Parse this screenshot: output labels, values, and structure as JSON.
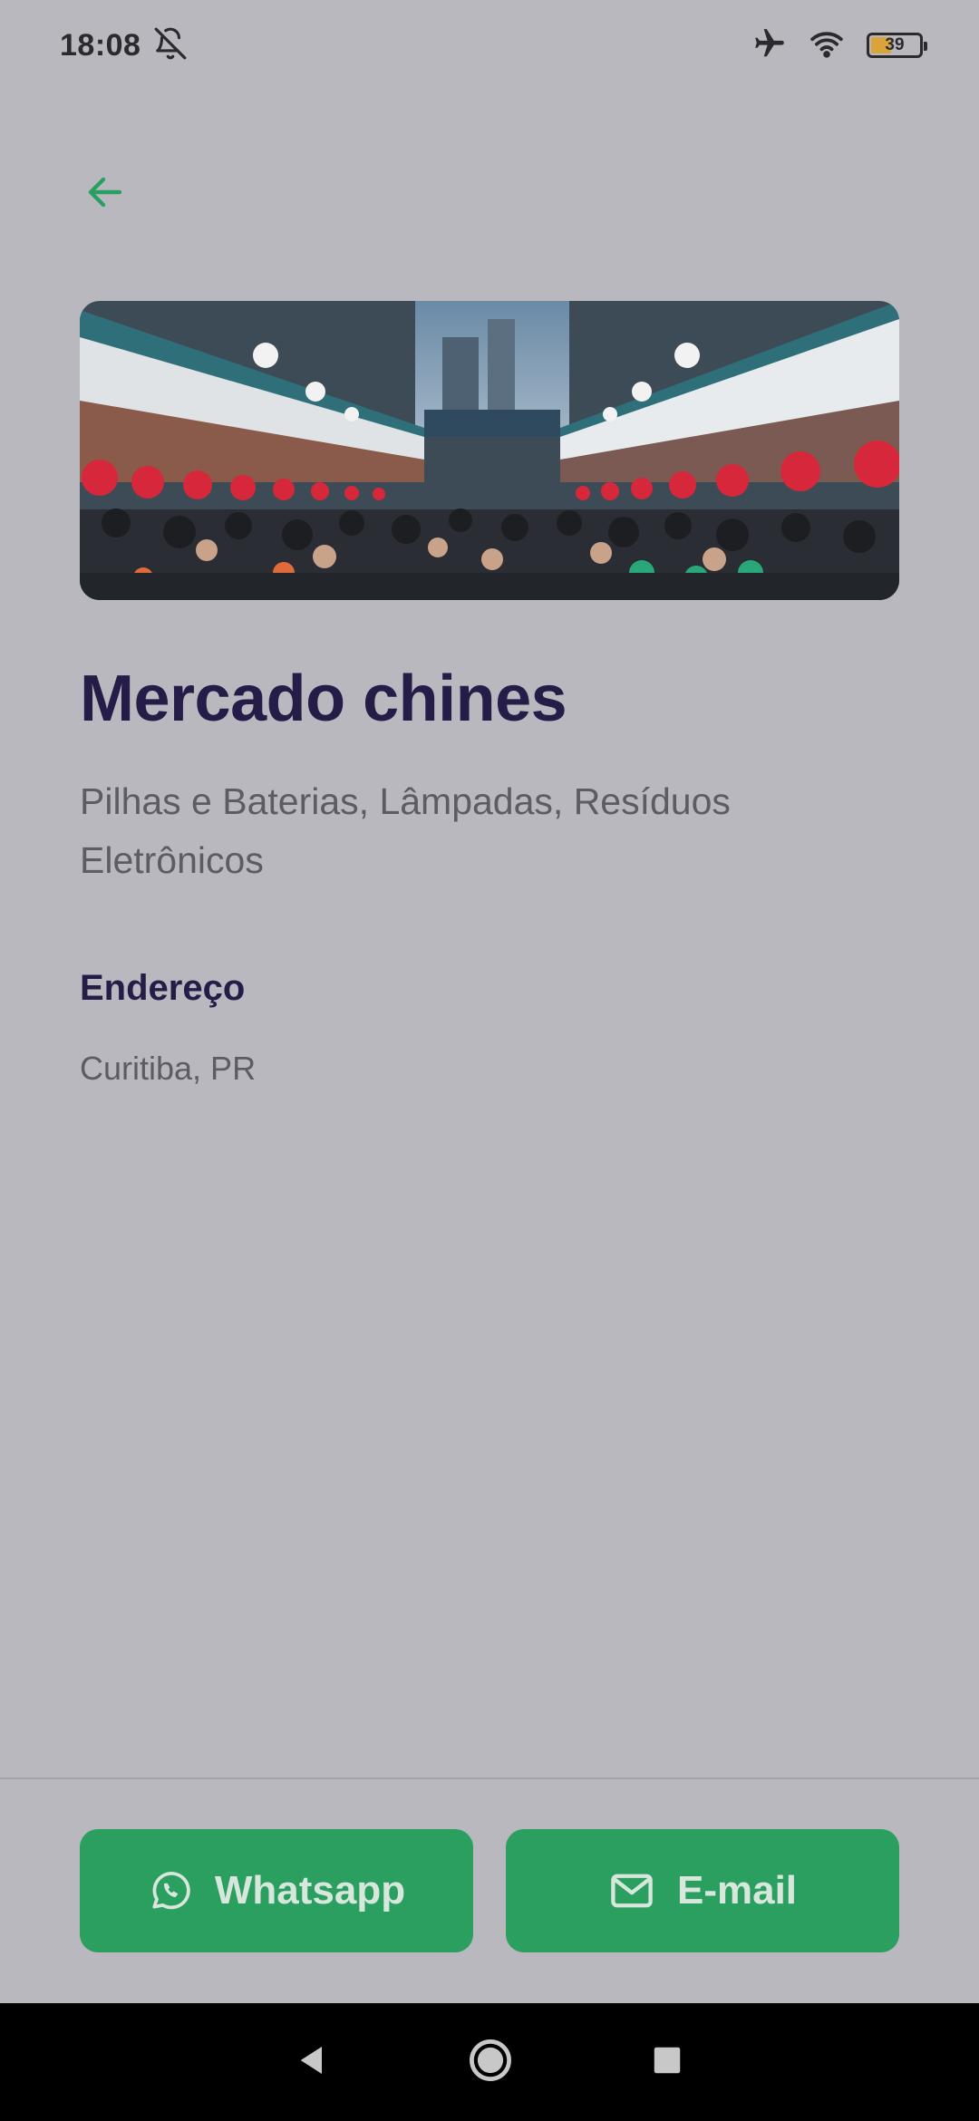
{
  "status_bar": {
    "time": "18:08",
    "battery": "39",
    "icons": [
      "bell-off-icon",
      "airplane-icon",
      "wifi-icon",
      "battery-icon"
    ]
  },
  "header": {
    "back_icon": "arrow-left-icon"
  },
  "place": {
    "name": "Mercado chines",
    "categories": "Pilhas e Baterias, Lâmpadas, Resíduos Eletrônicos",
    "address_heading": "Endereço",
    "address": "Curitiba, PR"
  },
  "actions": {
    "whatsapp_label": "Whatsapp",
    "email_label": "E-mail"
  },
  "colors": {
    "accent": "#2a9f60",
    "title": "#261c48",
    "background": "#b9b8be"
  }
}
